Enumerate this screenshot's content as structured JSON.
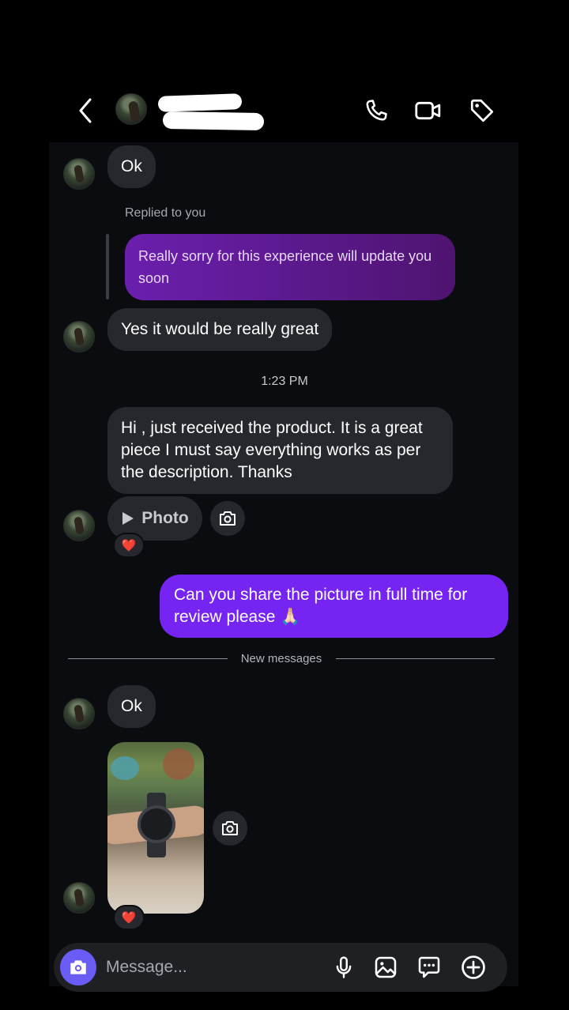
{
  "messages": [
    {
      "id": "m1",
      "text": "Ok"
    },
    {
      "id": "m2",
      "reply_label": "Replied to you",
      "quoted": "Really sorry for this experience will update you soon",
      "text": "Yes it would be really great"
    },
    {
      "id": "m3",
      "text": "Hi , just received the product. It is a great piece I must say everything works as per the description. Thanks"
    },
    {
      "id": "m4",
      "attachment_label": "Photo",
      "reaction": "❤️"
    },
    {
      "id": "m5",
      "text": "Can you share the picture in full time for review please 🙏🏻"
    },
    {
      "id": "m6",
      "text": "Ok"
    },
    {
      "id": "m7",
      "reaction": "❤️"
    }
  ],
  "timestamp": "1:23 PM",
  "divider_label": "New messages",
  "composer": {
    "placeholder": "Message..."
  },
  "colors": {
    "outgoing": "#7624f2",
    "incoming": "#26282d",
    "camera_button": "#6a5df5",
    "background": "#0b0c10"
  },
  "icons": {
    "header": [
      "back-icon",
      "phone-icon",
      "video-icon",
      "tag-icon"
    ],
    "composer": [
      "camera-icon",
      "microphone-icon",
      "gallery-icon",
      "sticker-icon",
      "plus-icon"
    ]
  }
}
